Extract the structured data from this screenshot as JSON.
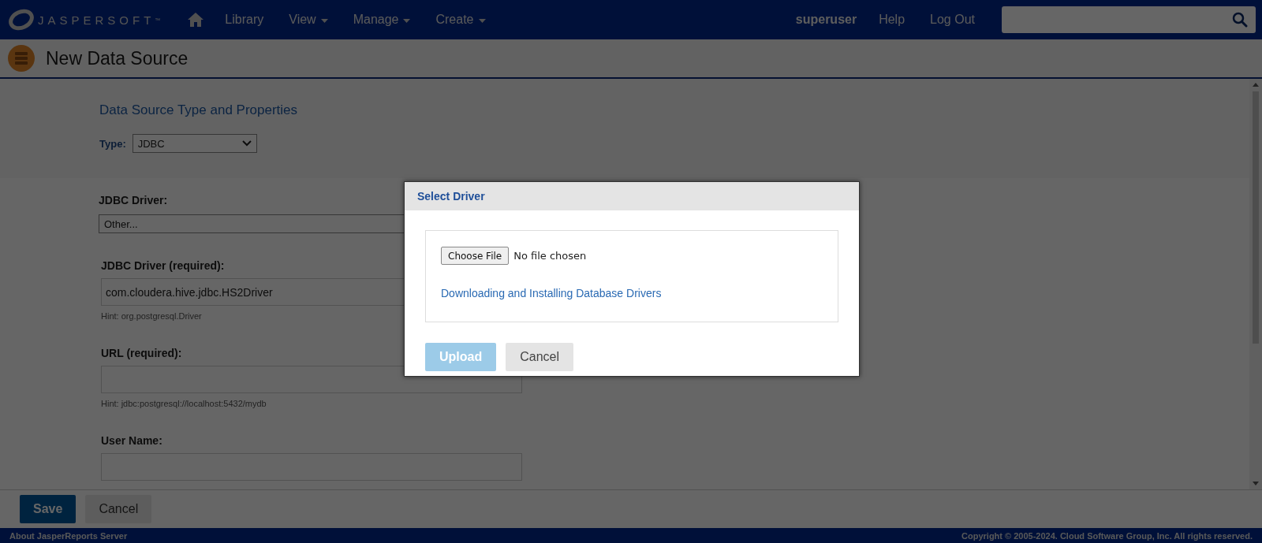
{
  "header": {
    "logo_text": "JASPERSOFT",
    "logo_mark": "™",
    "nav": [
      {
        "kind": "home"
      },
      {
        "kind": "link",
        "label": "Library"
      },
      {
        "kind": "menu",
        "label": "View"
      },
      {
        "kind": "menu",
        "label": "Manage"
      },
      {
        "kind": "menu",
        "label": "Create"
      }
    ],
    "user": "superuser",
    "links": [
      "Help",
      "Log Out"
    ]
  },
  "page": {
    "title": "New Data Source"
  },
  "form": {
    "section_title": "Data Source Type and Properties",
    "type_label": "Type:",
    "type_value": "JDBC",
    "driver_select_label": "JDBC Driver:",
    "driver_select_value": "Other...",
    "fields": [
      {
        "label": "JDBC Driver (required):",
        "value": "com.cloudera.hive.jdbc.HS2Driver",
        "hint": "Hint: org.postgresql.Driver"
      },
      {
        "label": "URL (required):",
        "hint": "Hint: jdbc:postgresql://localhost:5432/mydb"
      },
      {
        "label": "User Name:"
      }
    ]
  },
  "actions": [
    "Save",
    "Cancel"
  ],
  "footer": {
    "left": "About JasperReports Server",
    "right": "Copyright © 2005-2024. Cloud Software Group, Inc. All rights reserved."
  },
  "dialog": {
    "title": "Select Driver",
    "file_button": "Choose File",
    "file_status": "No file chosen",
    "link": "Downloading and Installing Database Drivers",
    "buttons": [
      {
        "label": "Upload",
        "disabled": true
      },
      {
        "label": "Cancel",
        "disabled": false
      }
    ]
  }
}
